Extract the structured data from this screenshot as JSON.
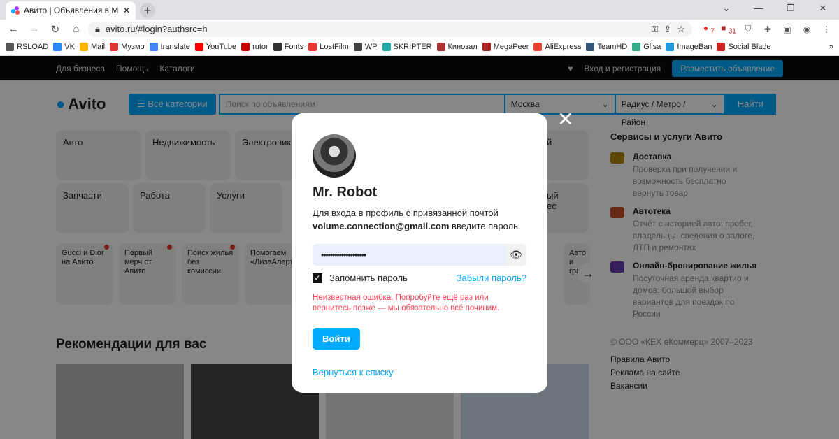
{
  "browser": {
    "tab_title": "Авито | Объявления в Москве: н",
    "url": "avito.ru/#login?authsrc=h",
    "new_tab": "+",
    "ext_badges": [
      "7",
      "31"
    ],
    "bookmarks": [
      {
        "label": "RSLOAD",
        "color": "#555"
      },
      {
        "label": "VK",
        "color": "#2787f5"
      },
      {
        "label": "Mail",
        "color": "#ffb300"
      },
      {
        "label": "Музмо",
        "color": "#d33"
      },
      {
        "label": "translate",
        "color": "#4285f4"
      },
      {
        "label": "YouTube",
        "color": "#f00"
      },
      {
        "label": "rutor",
        "color": "#c00"
      },
      {
        "label": "Fonts",
        "color": "#333"
      },
      {
        "label": "LostFilm",
        "color": "#e33"
      },
      {
        "label": "WP",
        "color": "#444"
      },
      {
        "label": "SKRIPTER",
        "color": "#2aa"
      },
      {
        "label": "Кинозал",
        "color": "#a33"
      },
      {
        "label": "MegaPeer",
        "color": "#a22"
      },
      {
        "label": "AliExpress",
        "color": "#e43"
      },
      {
        "label": "TeamHD",
        "color": "#357"
      },
      {
        "label": "Glisa",
        "color": "#3a8"
      },
      {
        "label": "ImageBan",
        "color": "#29d"
      },
      {
        "label": "Social Blade",
        "color": "#c22"
      }
    ],
    "more": "»"
  },
  "nav": {
    "business": "Для бизнеса",
    "help": "Помощь",
    "catalogs": "Каталоги",
    "login": "Вход и регистрация",
    "post_ad": "Разместить объявление"
  },
  "search": {
    "logo": "Avito",
    "all_categories": "Все категории",
    "placeholder": "Поиск по объявлениям",
    "city": "Москва",
    "radius": "Радиус / Метро / Район",
    "find": "Найти"
  },
  "categories": [
    "Авто",
    "Недвижимость",
    "Электроника",
    "Запчасти",
    "Работа",
    "Услуги"
  ],
  "right_cards": [
    "й",
    "ый",
    "ес"
  ],
  "promos": [
    {
      "label": "Gucci и Dior на Авито"
    },
    {
      "label": "Первый мерч от Авито"
    },
    {
      "label": "Поиск жилья без комиссии"
    },
    {
      "label": "Помогаем «ЛизаАлерт»"
    },
    {
      "label": "Авто и грани"
    }
  ],
  "recommendations": "Рекомендации для вас",
  "services": {
    "title": "Сервисы и услуги Авито",
    "items": [
      {
        "title": "Доставка",
        "desc": "Проверка при получении и возможность бесплатно вернуть товар",
        "color": "#b8860b"
      },
      {
        "title": "Автотека",
        "desc": "Отчёт с историей авто: пробег, владельцы, сведения о залоге, ДТП и ремонтах",
        "color": "#c0502a"
      },
      {
        "title": "Онлайн-бронирование жилья",
        "desc": "Посуточная аренда квартир и домов: большой выбор вариантов для поездок по России",
        "color": "#6a3fb0"
      }
    ]
  },
  "footer": {
    "copyright": "© ООО «КЕХ еКоммерц» 2007–2023",
    "links": [
      "Правила Авито",
      "Реклама на сайте",
      "Вакансии"
    ]
  },
  "modal": {
    "name": "Mr. Robot",
    "desc_prefix": "Для входа в профиль с привязанной почтой",
    "email": "volume.connection@gmail.com",
    "desc_suffix": " введите пароль.",
    "password_mask": "••••••••••••••••••••",
    "remember": "Запомнить пароль",
    "remember_checked": true,
    "forgot": "Забыли пароль?",
    "error": "Неизвестная ошибка. Попробуйте ещё раз или вернитесь позже — мы обязательно всё починим.",
    "login": "Войти",
    "back": "Вернуться к списку"
  }
}
